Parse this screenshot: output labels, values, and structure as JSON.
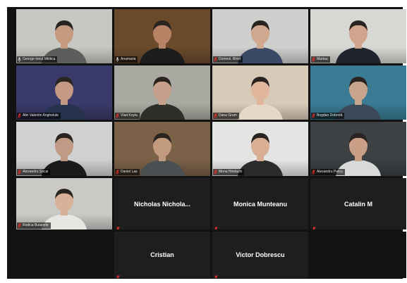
{
  "tiles": [
    {
      "label": "George-Ionut Mititica",
      "muted": false,
      "active": true,
      "bg": "#c7c8c2",
      "skin": "#c49a80",
      "shirt": "#5b5e5a"
    },
    {
      "label": "Anamaria",
      "muted": false,
      "active": false,
      "bg": "#6b4a2c",
      "skin": "#b68367",
      "shirt": "#1d1d1d"
    },
    {
      "label": "Domnel. Biriel",
      "muted": true,
      "active": false,
      "bg": "#cfcfcd",
      "skin": "#d0a78f",
      "shirt": "#3a4a66"
    },
    {
      "label": "Markac",
      "muted": true,
      "active": false,
      "bg": "#d7d7d3",
      "skin": "#cfa58d",
      "shirt": "#20242c"
    },
    {
      "label": "Alin Valentin Anghelute",
      "muted": true,
      "active": false,
      "bg": "#3a3a6a",
      "skin": "#c49a84",
      "shirt": "#27334c"
    },
    {
      "label": "Vlad Koyia",
      "muted": true,
      "active": false,
      "bg": "#a9a9a1",
      "skin": "#c6a08a",
      "shirt": "#2f2f2a"
    },
    {
      "label": "Dana Grum",
      "muted": true,
      "active": false,
      "bg": "#d8cab8",
      "skin": "#e0b79c",
      "shirt": "#e4d8c6"
    },
    {
      "label": "Bogdan Dobrotă",
      "muted": true,
      "active": false,
      "bg": "#3a7b94",
      "skin": "#c9a48c",
      "shirt": "#3b4a5a"
    },
    {
      "label": "Alexandru Socai",
      "muted": true,
      "active": false,
      "bg": "#cfd1d0",
      "skin": "#c09a84",
      "shirt": "#1b1b1b"
    },
    {
      "label": "Daniel Las",
      "muted": true,
      "active": false,
      "bg": "#7a6148",
      "skin": "#c29a7e",
      "shirt": "#4a4f52"
    },
    {
      "label": "Mona Hindachi",
      "muted": true,
      "active": false,
      "bg": "#e4e4e2",
      "skin": "#d8ae95",
      "shirt": "#2b2b2b"
    },
    {
      "label": "Alexandru Petcu",
      "muted": true,
      "active": false,
      "bg": "#3d4143",
      "skin": "#c99f86",
      "shirt": "#d8dad9"
    },
    {
      "label": "Rodica Butanele",
      "muted": true,
      "active": false,
      "bg": "#cbc9c6",
      "skin": "#d8b199",
      "shirt": "#e8e6e2"
    }
  ],
  "name_tiles": [
    {
      "name": "Nicholas  Nichola...",
      "muted": true
    },
    {
      "name": "Monica Munteanu",
      "muted": true
    },
    {
      "name": "Catalin M",
      "muted": true
    },
    {
      "name": "Cristian",
      "muted": true
    },
    {
      "name": "Victor Dobrescu",
      "muted": true
    }
  ],
  "icons": {
    "mic_muted": "mic-muted-icon",
    "mic": "microphone-icon"
  },
  "colors": {
    "active_speaker": "#9de35a",
    "muted_red": "#e0312b",
    "tile_dark": "#1e1e1e"
  }
}
